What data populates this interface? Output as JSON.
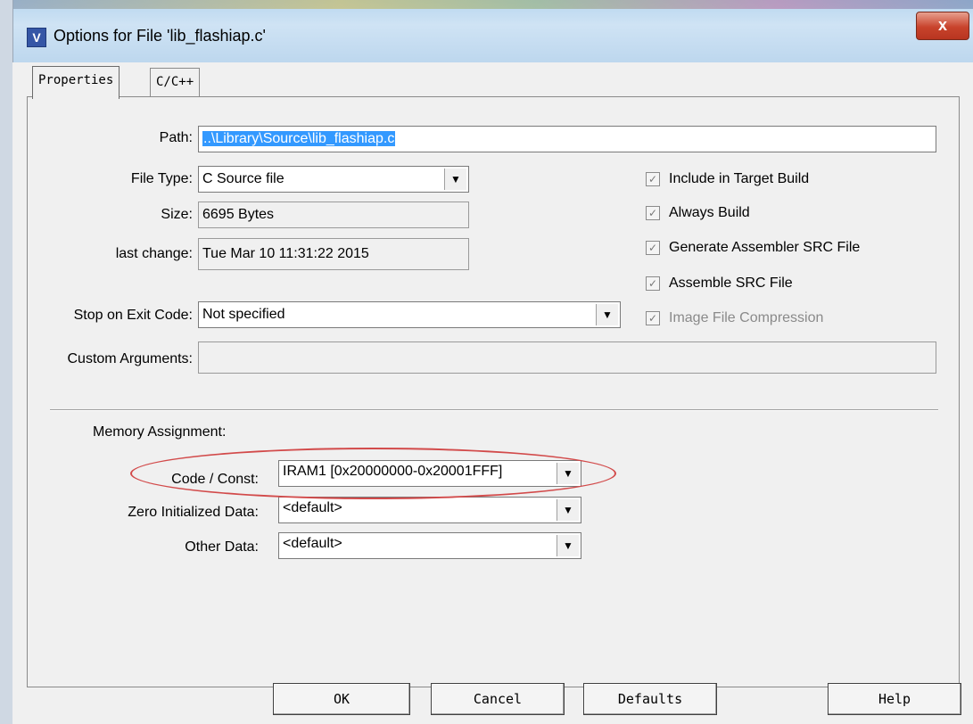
{
  "window": {
    "title": "Options for File 'lib_flashiap.c'",
    "app_icon": "keil-uv-icon",
    "close_label": "x"
  },
  "tabs": [
    {
      "label": "Properties",
      "active": true
    },
    {
      "label": "C/C++",
      "active": false
    }
  ],
  "properties": {
    "path_label": "Path:",
    "path_value": "..\\Library\\Source\\lib_flashiap.c",
    "file_type_label": "File Type:",
    "file_type_value": "C Source file",
    "size_label": "Size:",
    "size_value": "6695 Bytes",
    "last_change_label": "last change:",
    "last_change_value": "Tue Mar 10 11:31:22 2015",
    "stop_label": "Stop on Exit Code:",
    "stop_value": "Not specified",
    "custom_args_label": "Custom Arguments:",
    "custom_args_value": ""
  },
  "options": [
    {
      "label": "Include in Target Build",
      "checked": true,
      "enabled": true
    },
    {
      "label": "Always Build",
      "checked": true,
      "enabled": true
    },
    {
      "label": "Generate Assembler SRC File",
      "checked": true,
      "enabled": true
    },
    {
      "label": "Assemble SRC File",
      "checked": true,
      "enabled": true
    },
    {
      "label": "Image File Compression",
      "checked": true,
      "enabled": false
    }
  ],
  "memory": {
    "heading": "Memory Assignment:",
    "code_const_label": "Code / Const:",
    "code_const_value": "IRAM1 [0x20000000-0x20001FFF]",
    "zero_init_label": "Zero Initialized Data:",
    "zero_init_value": "<default>",
    "other_label": "Other Data:",
    "other_value": "<default>"
  },
  "buttons": {
    "ok": "OK",
    "cancel": "Cancel",
    "defaults": "Defaults",
    "help": "Help"
  },
  "colors": {
    "selection": "#3399ff",
    "annotation_ellipse": "#d24a4a",
    "close_button": "#c8432c"
  }
}
